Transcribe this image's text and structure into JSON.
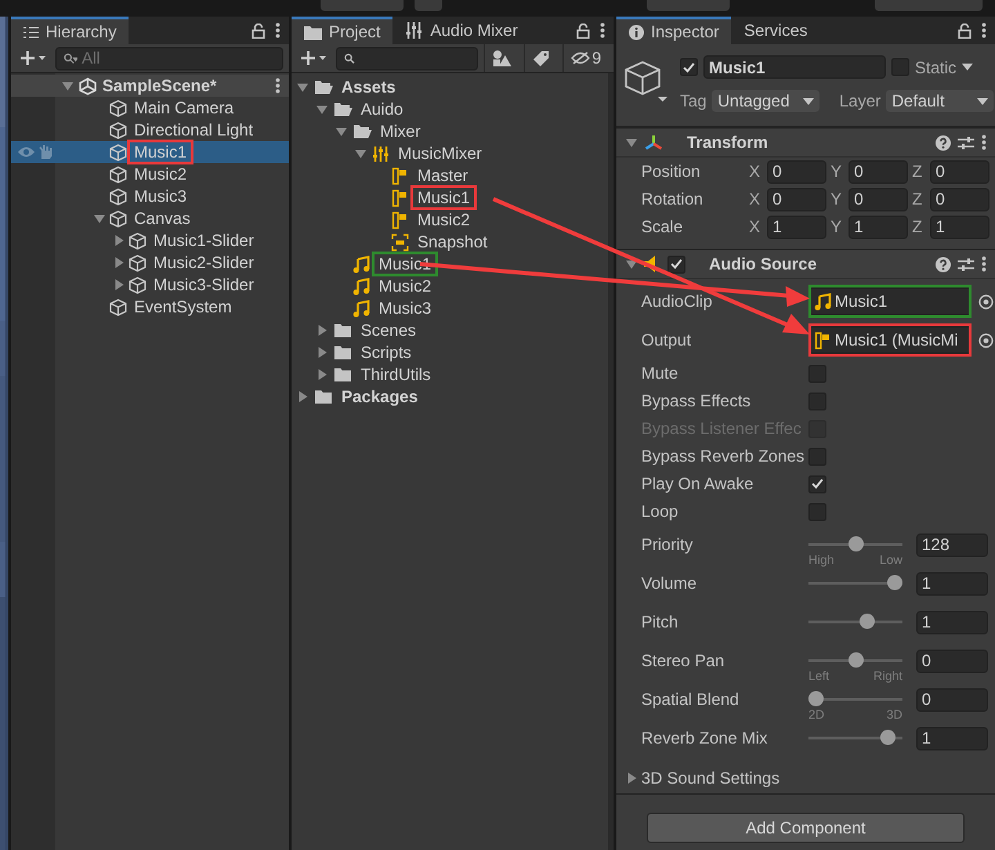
{
  "hierarchy": {
    "tab": "Hierarchy",
    "search_placeholder": "All",
    "scene": "SampleScene*",
    "items": [
      {
        "label": "Main Camera",
        "selected": false
      },
      {
        "label": "Directional Light",
        "selected": false
      },
      {
        "label": "Music1",
        "selected": true,
        "color": "#e8393b"
      },
      {
        "label": "Music2",
        "selected": false
      },
      {
        "label": "Music3",
        "selected": false
      },
      {
        "label": "Canvas",
        "selected": false,
        "expanded": true,
        "children": [
          {
            "label": "Music1-Slider",
            "selected": false,
            "expanded": false
          },
          {
            "label": "Music2-Slider",
            "selected": false,
            "expanded": false
          },
          {
            "label": "Music3-Slider",
            "selected": false,
            "expanded": false
          }
        ]
      },
      {
        "label": "EventSystem",
        "selected": false
      }
    ]
  },
  "project": {
    "tabs": [
      {
        "label": "Project",
        "kind": "project",
        "selected": true
      },
      {
        "label": "Audio Mixer",
        "kind": "mixer",
        "selected": false
      }
    ],
    "hidden_count": "9",
    "tree": [
      {
        "label": "Assets",
        "kind": "folder",
        "bold": true,
        "expanded": true,
        "children": [
          {
            "label": "Auido",
            "kind": "folder",
            "bold": false,
            "expanded": true,
            "children": [
              {
                "label": "Mixer",
                "kind": "folder",
                "bold": false,
                "expanded": true,
                "children": [
                  {
                    "label": "MusicMixer",
                    "kind": "mixer",
                    "bold": false,
                    "expanded": true,
                    "children": [
                      {
                        "label": "Master",
                        "kind": "group",
                        "bold": false
                      },
                      {
                        "label": "Music1",
                        "kind": "group",
                        "bold": false,
                        "color": "#e8393b"
                      },
                      {
                        "label": "Music2",
                        "kind": "group",
                        "bold": false
                      },
                      {
                        "label": "Snapshot",
                        "kind": "snapshot",
                        "bold": false
                      }
                    ]
                  }
                ]
              },
              {
                "label": "Music1",
                "kind": "clip",
                "bold": false,
                "color": "#2e8b2e"
              },
              {
                "label": "Music2",
                "kind": "clip",
                "bold": false
              },
              {
                "label": "Music3",
                "kind": "clip",
                "bold": false
              }
            ]
          },
          {
            "label": "Scenes",
            "kind": "closed_folder",
            "bold": false,
            "expanded": false
          },
          {
            "label": "Scripts",
            "kind": "closed_folder",
            "bold": false,
            "expanded": false
          },
          {
            "label": "ThirdUtils",
            "kind": "closed_folder",
            "bold": false,
            "expanded": false
          }
        ]
      },
      {
        "label": "Packages",
        "kind": "closed_folder",
        "bold": true,
        "expanded": false
      }
    ]
  },
  "inspector": {
    "tabs": [
      {
        "label": "Inspector",
        "selected": true
      },
      {
        "label": "Services",
        "selected": false
      }
    ],
    "object": {
      "name": "Music1",
      "active": true,
      "static": false,
      "static_label": "Static",
      "tag_label": "Tag",
      "tag": "Untagged",
      "layer_label": "Layer",
      "layer": "Default"
    },
    "transform": {
      "title": "Transform",
      "expanded": true,
      "rows": [
        {
          "label": "Position",
          "values": [
            {
              "axis": "X",
              "value": "0"
            },
            {
              "axis": "Y",
              "value": "0"
            },
            {
              "axis": "Z",
              "value": "0"
            }
          ]
        },
        {
          "label": "Rotation",
          "values": [
            {
              "axis": "X",
              "value": "0"
            },
            {
              "axis": "Y",
              "value": "0"
            },
            {
              "axis": "Z",
              "value": "0"
            }
          ]
        },
        {
          "label": "Scale",
          "values": [
            {
              "axis": "X",
              "value": "1"
            },
            {
              "axis": "Y",
              "value": "1"
            },
            {
              "axis": "Z",
              "value": "1"
            }
          ]
        }
      ]
    },
    "audio_source": {
      "title": "Audio Source",
      "enabled": true,
      "expanded": true,
      "fields": [
        {
          "kind": "object",
          "label": "AudioClip",
          "value": "Music1",
          "color": "#2e8b2e"
        },
        {
          "kind": "object",
          "label": "Output",
          "value": "Music1 (MusicMi",
          "color": "#e8393b"
        },
        {
          "kind": "checkbox",
          "label": "Mute",
          "checked": false,
          "disabled": false
        },
        {
          "kind": "checkbox",
          "label": "Bypass Effects",
          "checked": false,
          "disabled": false
        },
        {
          "kind": "checkbox",
          "label": "Bypass Listener Effec",
          "checked": false,
          "disabled": true
        },
        {
          "kind": "checkbox",
          "label": "Bypass Reverb Zones",
          "checked": false,
          "disabled": false
        },
        {
          "kind": "checkbox",
          "label": "Play On Awake",
          "checked": true,
          "disabled": false
        },
        {
          "kind": "checkbox",
          "label": "Loop",
          "checked": false,
          "disabled": false
        },
        {
          "kind": "slider",
          "label": "Priority",
          "level": 0.5,
          "value": "128",
          "min_label": "High",
          "max_label": "Low"
        },
        {
          "kind": "slider",
          "label": "Volume",
          "level": 1.0,
          "value": "1"
        },
        {
          "kind": "slider",
          "label": "Pitch",
          "level": 0.65,
          "value": "1"
        },
        {
          "kind": "slider",
          "label": "Stereo Pan",
          "level": 0.5,
          "value": "0",
          "min_label": "Left",
          "max_label": "Right"
        },
        {
          "kind": "slider",
          "label": "Spatial Blend",
          "level": 0.0,
          "value": "0",
          "min_label": "2D",
          "max_label": "3D"
        },
        {
          "kind": "slider",
          "label": "Reverb Zone Mix",
          "level": 0.91,
          "value": "1"
        }
      ],
      "foldout": {
        "label": "3D Sound Settings",
        "expanded": false
      }
    },
    "add_button": "Add Component"
  }
}
